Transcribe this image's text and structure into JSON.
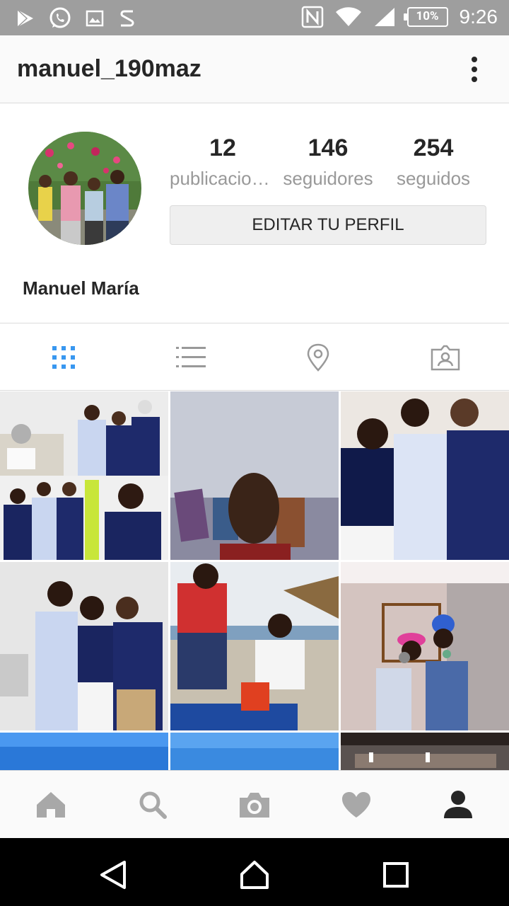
{
  "status_bar": {
    "time": "9:26",
    "battery": "10%",
    "left_icons": [
      "play-store-icon",
      "whatsapp-icon",
      "gallery-icon",
      "s-app-icon"
    ],
    "right_icons": [
      "nfc-icon",
      "wifi-icon",
      "signal-icon",
      "battery-icon"
    ]
  },
  "header": {
    "username": "manuel_190maz",
    "menu_icon": "overflow-menu-icon"
  },
  "profile": {
    "posts_count": "12",
    "posts_label": "publicaciones",
    "followers_count": "146",
    "followers_label": "seguidores",
    "following_count": "254",
    "following_label": "seguidos",
    "edit_button": "EDITAR TU PERFIL",
    "full_name": "Manuel María"
  },
  "tabs": [
    {
      "name": "grid-view",
      "icon": "grid-icon",
      "active": true
    },
    {
      "name": "list-view",
      "icon": "list-icon",
      "active": false
    },
    {
      "name": "map-view",
      "icon": "location-pin-icon",
      "active": false
    },
    {
      "name": "tagged-view",
      "icon": "tagged-person-icon",
      "active": false
    }
  ],
  "bottom_nav": [
    "home-icon",
    "search-icon",
    "camera-icon",
    "heart-icon",
    "profile-icon"
  ],
  "colors": {
    "accent": "#3897f0",
    "text": "#262626",
    "muted": "#999999",
    "statusbar": "#9e9e9e"
  }
}
